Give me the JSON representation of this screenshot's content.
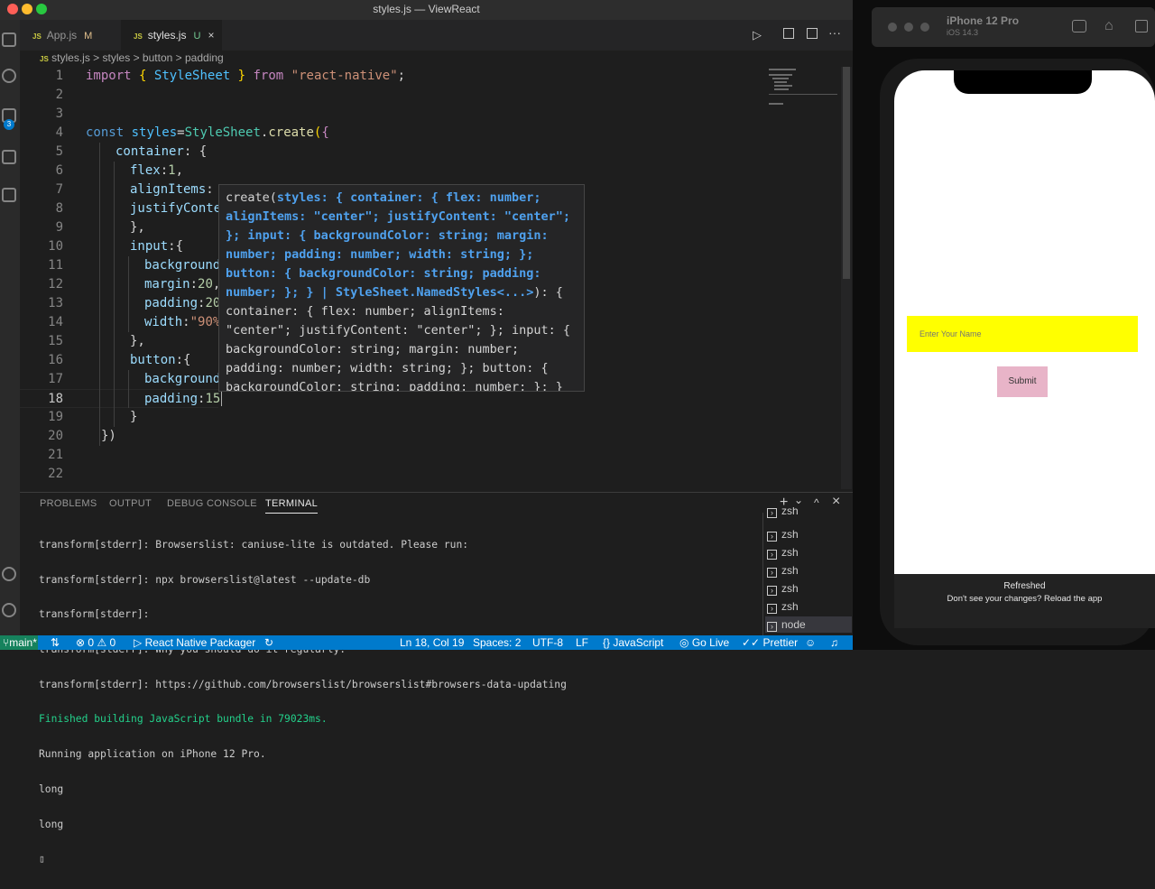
{
  "window": {
    "title": "styles.js — ViewReact"
  },
  "tabs": [
    {
      "label": "App.js",
      "badge": "JS",
      "status": "M"
    },
    {
      "label": "styles.js",
      "badge": "JS",
      "status": "U"
    }
  ],
  "breadcrumbs": [
    "styles.js",
    "styles",
    "button",
    "padding"
  ],
  "breadcrumb_sep": ">",
  "editor": {
    "lines": [
      {
        "n": "1"
      },
      {
        "n": "2"
      },
      {
        "n": "3"
      },
      {
        "n": "4"
      },
      {
        "n": "5"
      },
      {
        "n": "6"
      },
      {
        "n": "7"
      },
      {
        "n": "8"
      },
      {
        "n": "9"
      },
      {
        "n": "10"
      },
      {
        "n": "11"
      },
      {
        "n": "12"
      },
      {
        "n": "13"
      },
      {
        "n": "14"
      },
      {
        "n": "15"
      },
      {
        "n": "16"
      },
      {
        "n": "17"
      },
      {
        "n": "18"
      },
      {
        "n": "19"
      },
      {
        "n": "20"
      },
      {
        "n": "21"
      },
      {
        "n": "22"
      }
    ],
    "code": {
      "l1_import": "import",
      "l1_brace_open": "{",
      "l1_name": "StyleSheet",
      "l1_brace_close": "}",
      "l1_from": "from",
      "l1_module": "\"react-native\"",
      "l1_semi": ";",
      "l4_const": "const",
      "l4_var": "styles",
      "l4_eq": "=",
      "l4_cls": "StyleSheet",
      "l4_dot": ".",
      "l4_fn": "create",
      "l4_paren": "(",
      "l4_brace": "{",
      "l5_key": "container",
      "l5_rest": ": {",
      "l6_key": "flex",
      "l6_colon": ":",
      "l6_val": "1",
      "l6_comma": ",",
      "l7_key": "alignItems",
      "l7_colon": ":",
      "l8_key": "justifyConte",
      "l9": "},",
      "l10_key": "input",
      "l10_rest": ":{",
      "l11_key": "background",
      "l12_key": "margin",
      "l12_colon": ":",
      "l12_val": "20",
      "l12_comma": ",",
      "l13_key": "padding",
      "l13_colon": ":",
      "l13_val": "20",
      "l14_key": "width",
      "l14_colon": ":",
      "l14_val": "\"90%",
      "l15": "},",
      "l16_key": "button",
      "l16_rest": ":{",
      "l17_key": "background",
      "l18_key": "padding",
      "l18_colon": ":",
      "l18_val": "15",
      "l19": "}",
      "l20": "})"
    },
    "tooltip": {
      "line1_fn": "create(",
      "line1_sig": "styles: { container: { flex: number;",
      "line2": "alignItems: \"center\"; justifyContent: \"center\";",
      "line3": "}; input: { backgroundColor: string; margin:",
      "line4": "number; padding: number; width: string; };",
      "line5": "button: { backgroundColor: string; padding:",
      "line6_hl": "number; }; } | StyleSheet.NamedStyles<...>",
      "line6_rest": "): {",
      "line7": "container: { flex: number; alignItems:",
      "line8": "\"center\"; justifyContent: \"center\"; }; input: {",
      "line9": "backgroundColor: string; margin: number;",
      "line10": "padding: number; width: string; }; button: {",
      "line11": "backgroundColor: string; padding: number; }; }"
    }
  },
  "panel": {
    "tabs": [
      "PROBLEMS",
      "OUTPUT",
      "DEBUG CONSOLE",
      "TERMINAL"
    ],
    "terminal_lines": [
      "transform[stderr]: Browserslist: caniuse-lite is outdated. Please run:",
      "transform[stderr]: npx browserslist@latest --update-db",
      "transform[stderr]:",
      "transform[stderr]: Why you should do it regularly:",
      "transform[stderr]: https://github.com/browserslist/browserslist#browsers-data-updating",
      "Finished building JavaScript bundle in 79023ms.",
      "Running application on iPhone 12 Pro.",
      "long",
      "long",
      "▯"
    ],
    "terminals": [
      "zsh",
      "zsh",
      "zsh",
      "zsh",
      "zsh",
      "zsh",
      "node"
    ],
    "icons": {
      "add": "+",
      "chevron": "⌄",
      "maximize": "^",
      "close": "×"
    }
  },
  "statusbar": {
    "branch": "main*",
    "errors": "0",
    "warnings": "0",
    "packager": "React Native Packager",
    "position": "Ln 18, Col 19",
    "spaces": "Spaces: 2",
    "encoding": "UTF-8",
    "eol": "LF",
    "language": "JavaScript",
    "golive": "Go Live",
    "prettier": "Prettier"
  },
  "simulator": {
    "device": "iPhone 12 Pro",
    "os": "iOS 14.3",
    "input_placeholder": "Enter Your Name",
    "submit_label": "Submit",
    "banner_title": "Refreshed",
    "banner_text": "Don't see your changes? Reload the app",
    "input_color": "#ffff00",
    "button_color": "#e8b4c8"
  },
  "activity_badge": "3",
  "colors": {
    "accent": "#007acc",
    "editor_bg": "#1e1e1e"
  }
}
